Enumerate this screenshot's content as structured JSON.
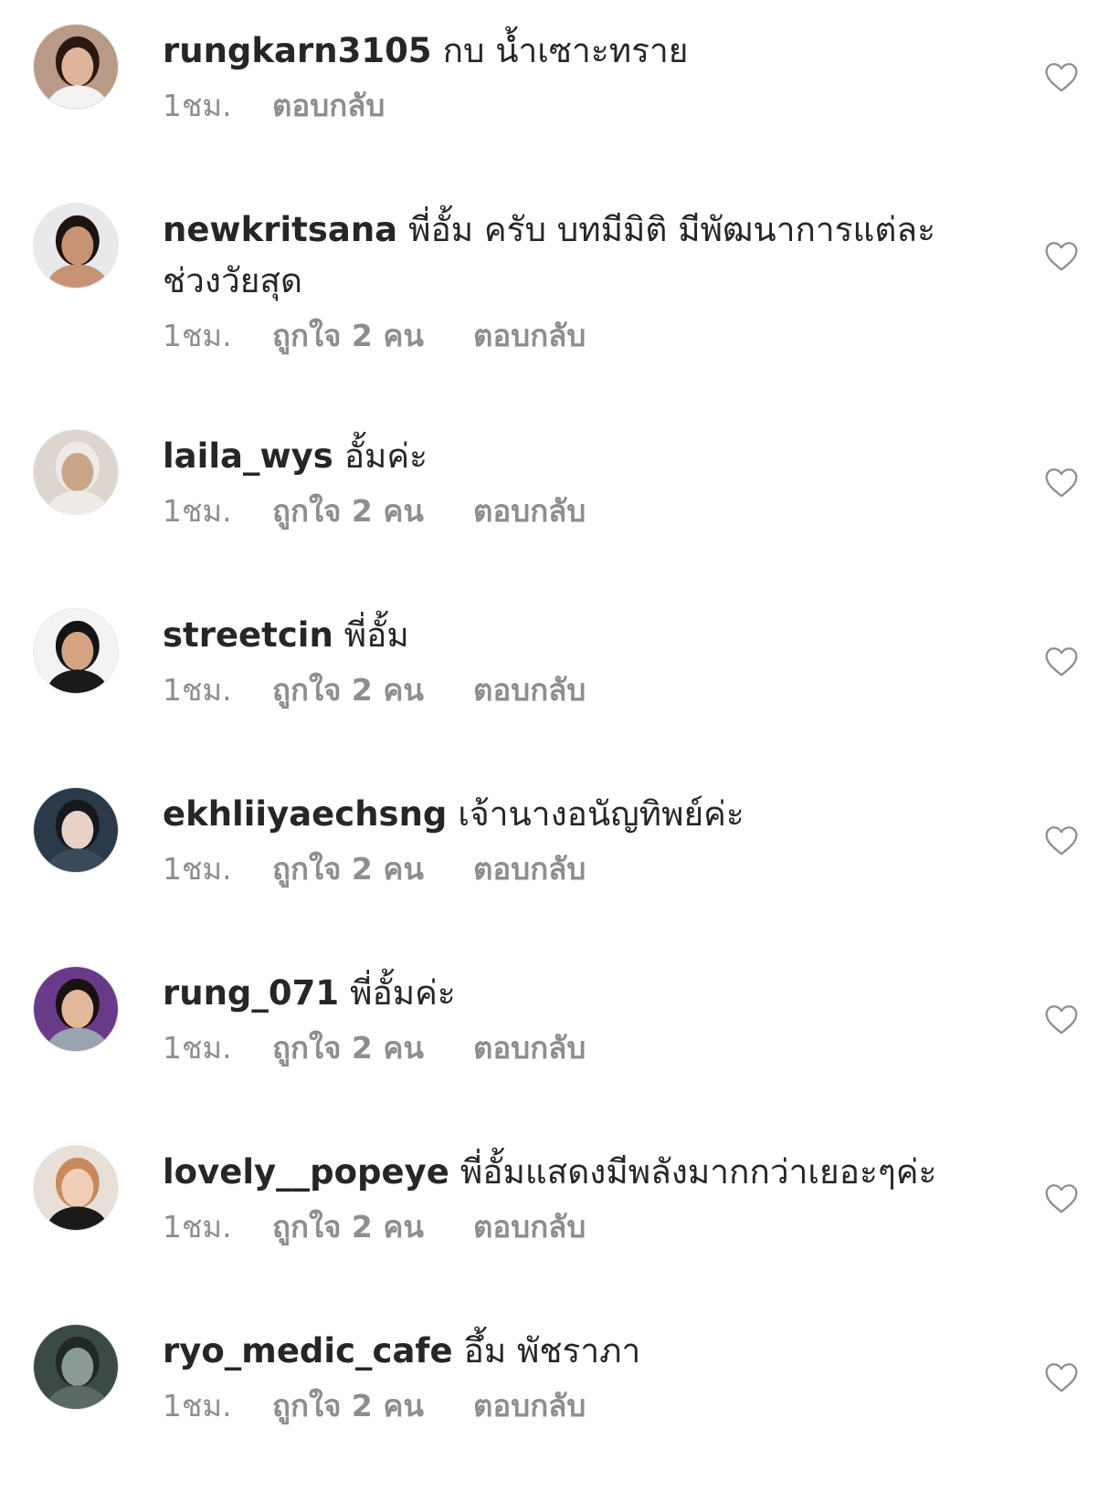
{
  "comments": [
    {
      "username": "rungkarn3105",
      "text": "กบ น้ำเซาะทราย",
      "time": "1ชม.",
      "likes": "",
      "reply": "ตอบกลับ",
      "avatar": {
        "bg": "#b89a86",
        "skin": "#e0b49a",
        "hair": "#2a1812",
        "shirt": "#f2f2f2"
      },
      "like_icon": "heart-outline-icon"
    },
    {
      "username": "newkritsana",
      "text": "พี่อั้ม ครับ บทมีมิติ มีพัฒนาการแต่ละช่วงวัยสุด",
      "time": "1ชม.",
      "likes": "ถูกใจ 2 คน",
      "reply": "ตอบกลับ",
      "avatar": {
        "bg": "#e9e9ec",
        "skin": "#c89274",
        "hair": "#1c1410",
        "shirt": "#c89274"
      },
      "like_icon": "heart-outline-icon"
    },
    {
      "username": "laila_wys",
      "text": "อั้มค่ะ",
      "time": "1ชม.",
      "likes": "ถูกใจ 2 คน",
      "reply": "ตอบกลับ",
      "avatar": {
        "bg": "#ddd6cf",
        "skin": "#c9a58a",
        "hair": "#eeeae6",
        "shirt": "#eeeae6"
      },
      "like_icon": "heart-outline-icon"
    },
    {
      "username": "streetcin",
      "text": "พี่อั้ม",
      "time": "1ชม.",
      "likes": "ถูกใจ 2 คน",
      "reply": "ตอบกลับ",
      "avatar": {
        "bg": "#f3f3f3",
        "skin": "#d3a482",
        "hair": "#141414",
        "shirt": "#1a1a1a"
      },
      "like_icon": "heart-outline-icon"
    },
    {
      "username": "ekhliiyaechsng",
      "text": "เจ้านางอนัญทิพย์ค่ะ",
      "time": "1ชม.",
      "likes": "ถูกใจ 2 คน",
      "reply": "ตอบกลับ",
      "avatar": {
        "bg": "#2a3a48",
        "skin": "#e8d2c6",
        "hair": "#15181d",
        "shirt": "#3b4a5a"
      },
      "like_icon": "heart-outline-icon"
    },
    {
      "username": "rung_071",
      "text": "พี่อั้มค่ะ",
      "time": "1ชม.",
      "likes": "ถูกใจ 2 คน",
      "reply": "ตอบกลับ",
      "avatar": {
        "bg": "#6a3a8a",
        "skin": "#e2b89a",
        "hair": "#1a120e",
        "shirt": "#9aa3b0"
      },
      "like_icon": "heart-outline-icon"
    },
    {
      "username": "lovely__popeye",
      "text": "พี่อั้มแสดงมีพลังมากกว่าเยอะๆค่ะ",
      "time": "1ชม.",
      "likes": "ถูกใจ 2 คน",
      "reply": "ตอบกลับ",
      "avatar": {
        "bg": "#e8e0d8",
        "skin": "#f0cdb6",
        "hair": "#c88a5a",
        "shirt": "#1a1a1a"
      },
      "like_icon": "heart-outline-icon"
    },
    {
      "username": "ryo_medic_cafe",
      "text": "อึ้ม พัชราภา",
      "time": "1ชม.",
      "likes": "ถูกใจ 2 คน",
      "reply": "ตอบกลับ",
      "avatar": {
        "bg": "#3a4a44",
        "skin": "#8a9a94",
        "hair": "#20282a",
        "shirt": "#5a6a64"
      },
      "like_icon": "heart-outline-icon"
    }
  ]
}
